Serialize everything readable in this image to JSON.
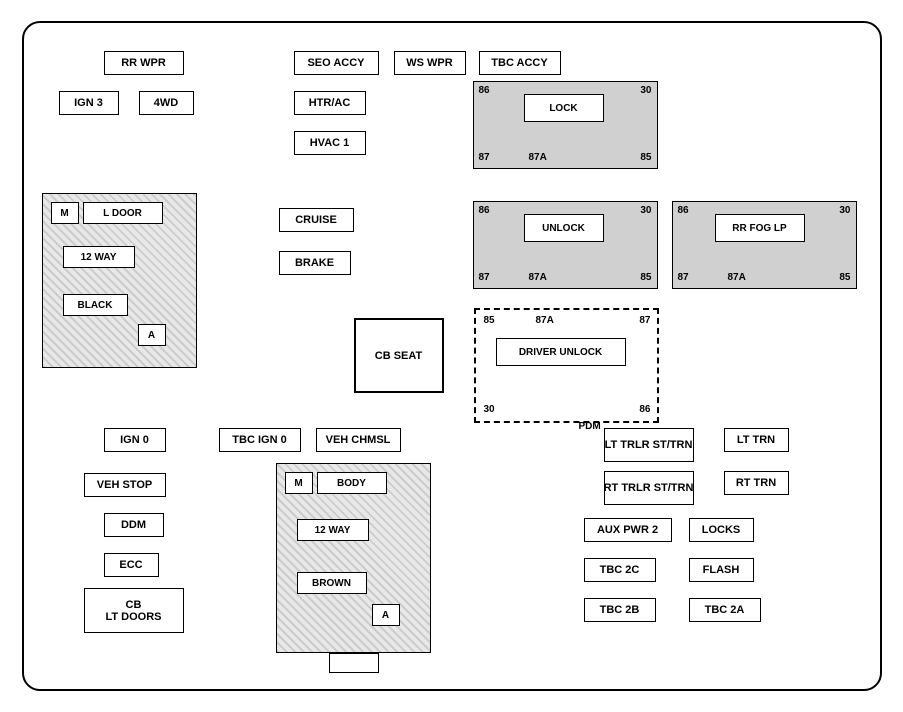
{
  "labels": {
    "rr_wpr": "RR WPR",
    "seo_accy": "SEO ACCY",
    "ws_wpr": "WS WPR",
    "tbc_accy": "TBC ACCY",
    "ign3": "IGN 3",
    "fwd": "4WD",
    "htr_ac": "HTR/AC",
    "hvac1": "HVAC 1",
    "cruise": "CRUISE",
    "brake": "BRAKE",
    "m_left": "M",
    "l_door": "L DOOR",
    "way12_left": "12 WAY",
    "black": "BLACK",
    "a_left": "A",
    "ign0": "IGN 0",
    "tbc_ign0": "TBC IGN 0",
    "veh_chmsl": "VEH CHMSL",
    "veh_stop": "VEH STOP",
    "ddm": "DDM",
    "ecc": "ECC",
    "cb_lt_doors": "CB\nLT DOORS",
    "m_right": "M",
    "body": "BODY",
    "way12_right": "12 WAY",
    "brown": "BROWN",
    "a_right": "A",
    "cb_seat": "CB\nSEAT",
    "lt_trlr": "LT TRLR\nST/TRN",
    "rt_trlr": "RT TRLR\nST/TRN",
    "lt_trn": "LT TRN",
    "rt_trn": "RT TRN",
    "aux_pwr2": "AUX PWR 2",
    "locks": "LOCKS",
    "tbc_2c": "TBC 2C",
    "flash": "FLASH",
    "tbc_2b": "TBC 2B",
    "tbc_2a": "TBC 2A",
    "lock_relay": "LOCK",
    "unlock_relay": "UNLOCK",
    "rr_fog_lp": "RR FOG LP",
    "driver_unlock": "DRIVER UNLOCK",
    "pdm": "PDM",
    "n86_lock": "86",
    "n30_lock": "30",
    "n87_lock": "87",
    "n87a_lock": "87A",
    "n85_lock": "85",
    "n86_unlock": "86",
    "n30_unlock": "30",
    "n87_unlock": "87",
    "n87a_unlock": "87A",
    "n85_unlock": "85",
    "n86_fog": "86",
    "n30_fog": "30",
    "n87_fog": "87",
    "n87a_fog": "87A",
    "n85_fog": "85",
    "n85_du": "85",
    "n87a_du": "87A",
    "n87_du": "87",
    "n30_du": "30",
    "n86_du": "86"
  }
}
